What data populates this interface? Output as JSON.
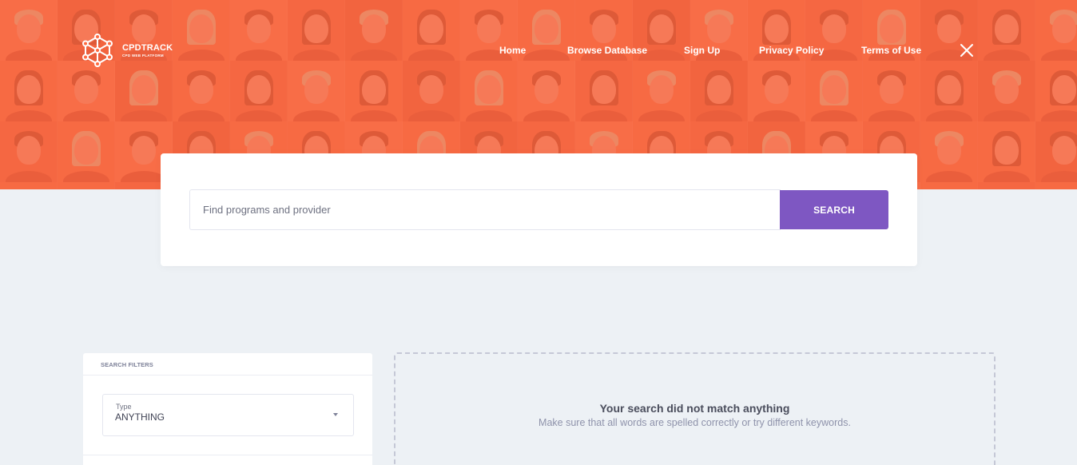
{
  "brand": {
    "name": "CPDTRACK",
    "tagline": "CPD WEB PLATFORM"
  },
  "nav": {
    "items": [
      {
        "label": "Home"
      },
      {
        "label": "Browse Database"
      },
      {
        "label": "Sign Up"
      },
      {
        "label": "Privacy Policy"
      },
      {
        "label": "Terms of Use"
      }
    ],
    "close_icon": "close-icon"
  },
  "search": {
    "placeholder": "Find programs and provider",
    "value": "",
    "button_label": "SEARCH"
  },
  "filters": {
    "header": "SEARCH FILTERS",
    "type": {
      "label": "Type",
      "value": "ANYTHING"
    }
  },
  "results": {
    "empty_title": "Your search did not match anything",
    "empty_message": "Make sure that all words are spelled correctly or try different keywords."
  },
  "colors": {
    "hero": "#ff6a40",
    "accent": "#7e57c2",
    "page_background": "#edf1f5"
  }
}
